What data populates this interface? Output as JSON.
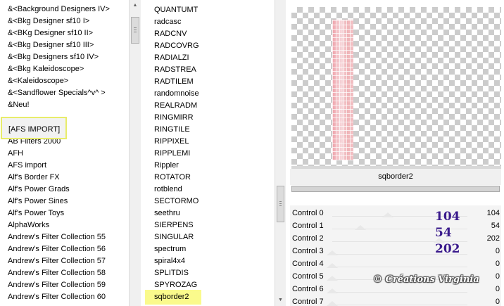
{
  "left_list": {
    "items": [
      "&<Background Designers IV>",
      "&<Bkg Designer sf10 I>",
      "&<BKg Designer sf10 II>",
      "&<Bkg Designer sf10 III>",
      "&<Bkg Designers sf10 IV>",
      "&<Bkg Kaleidoscope>",
      "&<Kaleidoscope>",
      "&<Sandflower Specials^v^ >",
      "&Neu!",
      "[AFS IMPORT]",
      "AB Filters 2000",
      "AFH",
      "AFS import",
      "Alf's Border FX",
      "Alf's Power Grads",
      "Alf's Power Sines",
      "Alf's Power Toys",
      "AlphaWorks",
      "Andrew's Filter Collection 55",
      "Andrew's Filter Collection 56",
      "Andrew's Filter Collection 57",
      "Andrew's Filter Collection 58",
      "Andrew's Filter Collection 59",
      "Andrew's Filter Collection 60"
    ],
    "selected": "[AFS IMPORT]"
  },
  "mid_list": {
    "items": [
      "QUANTUMT",
      "radcasc",
      "RADCNV",
      "RADCOVRG",
      "RADIALZI",
      "RADSTREA",
      "RADTILEM",
      "randomnoise",
      "REALRADM",
      "RINGMIRR",
      "RINGTILE",
      "RIPPIXEL",
      "RIPPLEMI",
      "Rippler",
      "ROTATOR",
      "rotblend",
      "SECTORMO",
      "seethru",
      "SIERPENS",
      "SINGULAR",
      "spectrum",
      "spiral4x4",
      "SPLITDIS",
      "SPYROZAG",
      "sqborder2"
    ],
    "selected": "sqborder2"
  },
  "filter": {
    "name": "sqborder2",
    "progress": 1.0
  },
  "controls": [
    {
      "label": "Control 0",
      "value": "104",
      "pos": 0.41
    },
    {
      "label": "Control 1",
      "value": "54",
      "pos": 0.21
    },
    {
      "label": "Control 2",
      "value": "202",
      "pos": 0.79
    },
    {
      "label": "Control 3",
      "value": "0",
      "pos": 0.0
    },
    {
      "label": "Control 4",
      "value": "0",
      "pos": 0.0
    },
    {
      "label": "Control 5",
      "value": "0",
      "pos": 0.0
    },
    {
      "label": "Control 6",
      "value": "0",
      "pos": 0.0
    },
    {
      "label": "Control 7",
      "value": "0",
      "pos": 0.0
    }
  ],
  "annotation_values": [
    "104",
    "54",
    "202"
  ],
  "watermark": "© Créations Virginia",
  "colors": {
    "highlight_box": "#e8ec6a",
    "selected_fill": "#fafa8c",
    "annotation": "#3a1a8c"
  }
}
